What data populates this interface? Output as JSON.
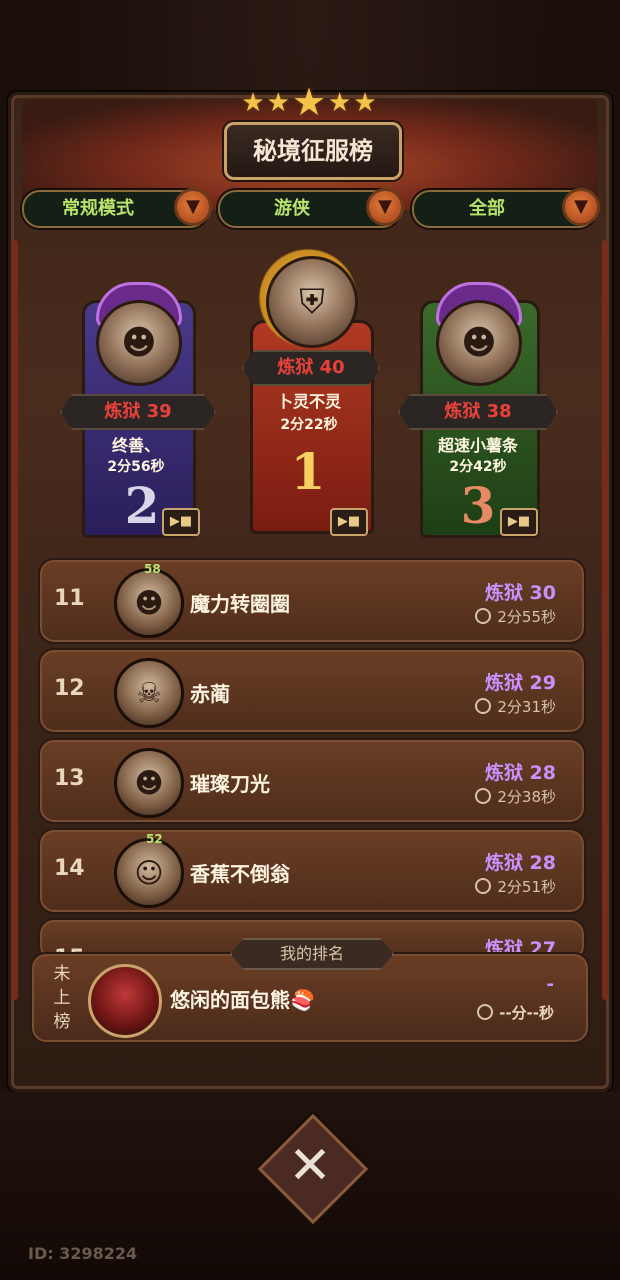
{
  "title": "秘境征服榜",
  "filters": [
    {
      "label": "常规模式"
    },
    {
      "label": "游侠"
    },
    {
      "label": "全部"
    }
  ],
  "podium": [
    {
      "rank": "1",
      "level": "炼狱 40",
      "name": "卜灵不灵",
      "time": "2分22秒"
    },
    {
      "rank": "2",
      "level": "炼狱 39",
      "name": "终善、",
      "time": "2分56秒"
    },
    {
      "rank": "3",
      "level": "炼狱 38",
      "name": "超速小薯条",
      "time": "2分42秒"
    }
  ],
  "rows": [
    {
      "rank": "11",
      "name": "魔力转圈圈",
      "level": "炼狱 30",
      "time": "2分55秒",
      "badge": "58"
    },
    {
      "rank": "12",
      "name": "赤蔺",
      "level": "炼狱 29",
      "time": "2分31秒"
    },
    {
      "rank": "13",
      "name": "璀璨刀光",
      "level": "炼狱 28",
      "time": "2分38秒"
    },
    {
      "rank": "14",
      "name": "香蕉不倒翁",
      "level": "炼狱 28",
      "time": "2分51秒",
      "badge": "52"
    },
    {
      "rank": "15",
      "name": "",
      "level": "炼狱 27",
      "time": ""
    }
  ],
  "my_rank": {
    "label": "我的排名",
    "status": "未上榜",
    "name": "悠闲的面包熊🍣",
    "level": "-",
    "time": "--分--秒"
  },
  "footer": {
    "user_id": "ID: 3298224"
  },
  "icons": {
    "close": "close-x-icon",
    "video": "video-camera-icon",
    "dropdown": "chevron-down-icon",
    "clock": "clock-icon"
  }
}
